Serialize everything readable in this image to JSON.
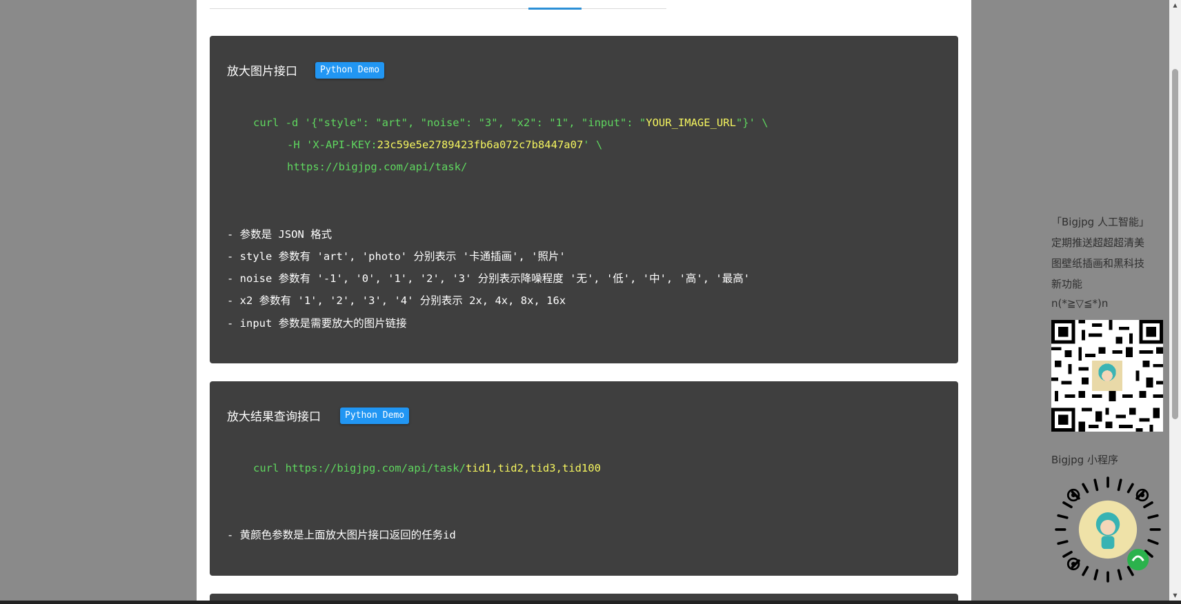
{
  "card1": {
    "title": "放大图片接口",
    "demo_label": "Python Demo",
    "code": {
      "l1_a": "curl -d '{\"style\": \"art\", \"noise\": \"3\", \"x2\": \"1\", \"input\": \"",
      "l1_b": "YOUR_IMAGE_URL",
      "l1_c": "\"}' \\",
      "l2_a": "-H 'X-API-KEY:",
      "l2_b": "23c59e5e2789423fb6a072c7b8447a07",
      "l2_c": "' \\",
      "l3": "https://bigjpg.com/api/task/"
    },
    "notes": [
      "- 参数是 JSON 格式",
      "- style 参数有 'art', 'photo' 分别表示 '卡通插画', '照片'",
      "- noise 参数有 '-1', '0', '1', '2', '3' 分别表示降噪程度 '无', '低', '中', '高', '最高'",
      "- x2 参数有 '1', '2', '3', '4' 分别表示 2x, 4x, 8x, 16x",
      "- input 参数是需要放大的图片链接"
    ]
  },
  "card2": {
    "title": "放大结果查询接口",
    "demo_label": "Python Demo",
    "code": {
      "a": "curl https://bigjpg.com/api/task/",
      "b": "tid1,tid2,tid3,tid100"
    },
    "notes": [
      "- 黄颜色参数是上面放大图片接口返回的任务id"
    ]
  },
  "sidebar": {
    "lines": [
      "「Bigjpg 人工智能」",
      "定期推送超超超清美",
      "图壁纸插画和黑科技",
      "新功能",
      "n(*≧▽≦*)n"
    ],
    "miniprogram_label": "Bigjpg 小程序"
  },
  "colors": {
    "overlay": "#8a8a8a",
    "card_bg": "#3f3f3f",
    "code_green": "#5fd75f",
    "code_yellow": "#f5f55f",
    "badge_blue": "#2196f3",
    "tab_active": "#2b8fd6"
  },
  "icons": {
    "qr": "wechat-qr-code",
    "mini_program": "mini-program-code"
  }
}
